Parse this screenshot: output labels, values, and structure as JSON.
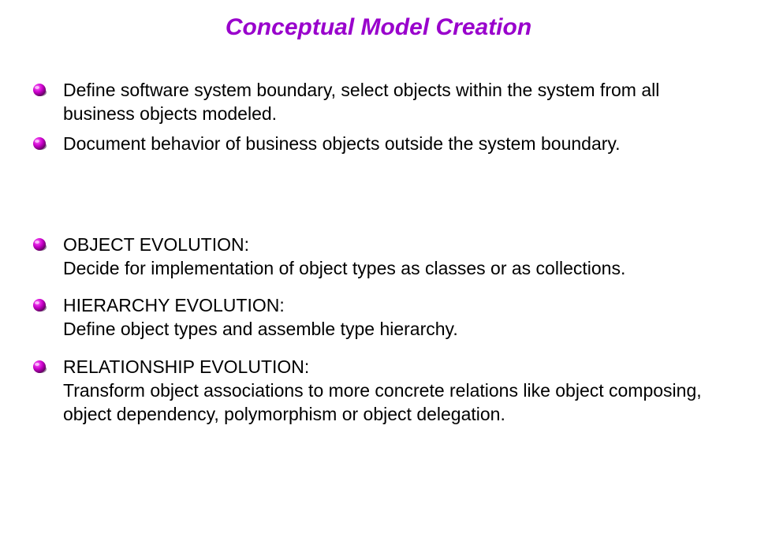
{
  "title": "Conceptual Model Creation",
  "group1": {
    "items": [
      "Define software system boundary, select objects within the system from all business objects modeled.",
      "Document behavior of business objects outside the system boundary."
    ]
  },
  "group2": {
    "items": [
      "OBJECT EVOLUTION:\nDecide for implementation of  object types as classes or as collections.",
      "HIERARCHY EVOLUTION:\nDefine object types and assemble type hierarchy.",
      "RELATIONSHIP EVOLUTION:\nTransform object associations to more concrete relations like object composing, object dependency, polymorphism or object delegation."
    ]
  }
}
